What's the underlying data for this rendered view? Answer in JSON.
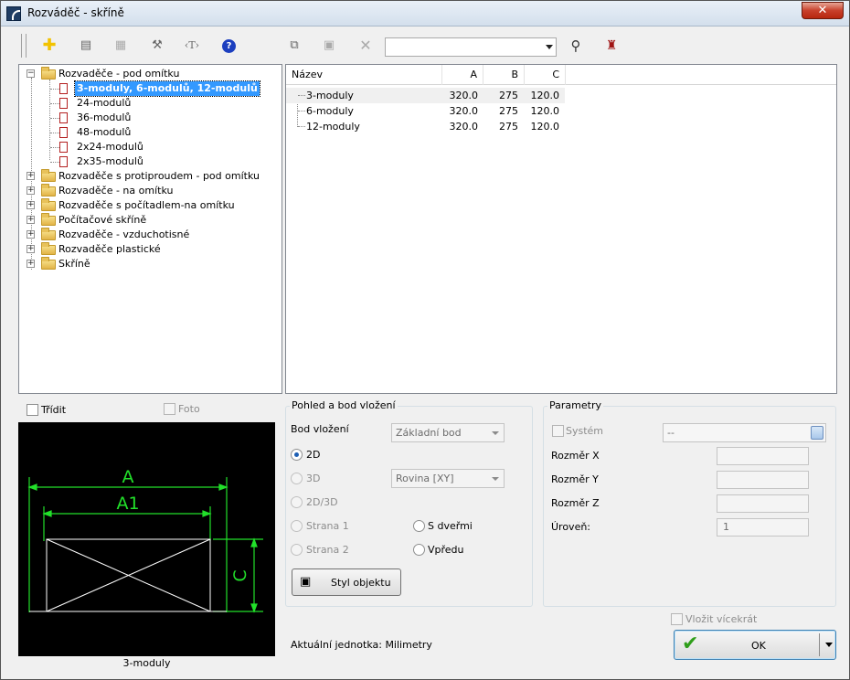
{
  "window": {
    "title": "Rozváděč - skříně",
    "close_label": "✕"
  },
  "toolbar": {
    "search_value": ""
  },
  "tree": {
    "root": "Rozvaděče - pod omítku",
    "children": [
      "3-moduly, 6-modulů, 12-modulů",
      "24-modulů",
      "36-modulů",
      "48-modulů",
      "2x24-modulů",
      "2x35-modulů"
    ],
    "folders": [
      "Rozvaděče s protiproudem - pod omítku",
      "Rozvaděče - na omítku",
      "Rozvaděče s počítadlem-na omítku",
      "Počítačové skříně",
      "Rozvaděče - vzduchotisné",
      "Rozvaděče plastické",
      "Skříně"
    ]
  },
  "list": {
    "headers": {
      "name": "Název",
      "a": "A",
      "b": "B",
      "c": "C"
    },
    "rows": [
      {
        "name": "3-moduly",
        "a": "320.0",
        "b": "275",
        "c": "120.0"
      },
      {
        "name": "6-moduly",
        "a": "320.0",
        "b": "275",
        "c": "120.0"
      },
      {
        "name": "12-moduly",
        "a": "320.0",
        "b": "275",
        "c": "120.0"
      }
    ]
  },
  "preview": {
    "sort_label": "Třídit",
    "photo_label": "Foto",
    "caption": "3-moduly",
    "dim_a": "A",
    "dim_a1": "A1",
    "dim_c": "C"
  },
  "insert": {
    "group_title": "Pohled a bod vložení",
    "point_label": "Bod vložení",
    "point_value": "Základní bod",
    "plane_value": "Rovina  [XY]",
    "radio_2d": "2D",
    "radio_3d": "3D",
    "radio_2d3d": "2D/3D",
    "radio_side1": "Strana 1",
    "radio_side2": "Strana 2",
    "radio_doors": "S dveřmi",
    "radio_front": "Vpředu",
    "style_button": "Styl objektu",
    "unit_text": "Aktuální jednotka: Milimetry"
  },
  "params": {
    "group_title": "Parametry",
    "system_label": "Systém",
    "system_value": "--",
    "dim_x": "Rozměr X",
    "dim_y": "Rozměr Y",
    "dim_z": "Rozměr Z",
    "level_label": "Úroveň:",
    "level_value": "1"
  },
  "footer": {
    "multi_insert": "Vložit vícekrát",
    "ok_label": "OK"
  },
  "colors": {
    "selection": "#3399ff",
    "drawing_green": "#22e02a"
  }
}
